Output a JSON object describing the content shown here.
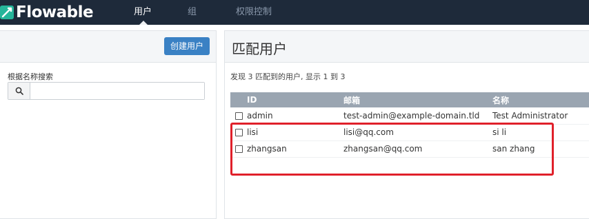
{
  "brand": {
    "name": "Flowable",
    "color": "#26b59a"
  },
  "nav": {
    "tabs": [
      {
        "label": "用户",
        "active": true
      },
      {
        "label": "组",
        "active": false
      },
      {
        "label": "权限控制",
        "active": false
      }
    ]
  },
  "left": {
    "create_button": "创建用户",
    "search_label": "根据名称搜索",
    "search_value": ""
  },
  "right": {
    "title": "匹配用户",
    "summary": "发现 3 匹配到的用户, 显示 1 到 3",
    "columns": [
      "ID",
      "邮箱",
      "名称"
    ],
    "rows": [
      {
        "id": "admin",
        "email": "test-admin@example-domain.tld",
        "name": "Test Administrator"
      },
      {
        "id": "lisi",
        "email": "lisi@qq.com",
        "name": "si li"
      },
      {
        "id": "zhangsan",
        "email": "zhangsan@qq.com",
        "name": "san zhang"
      }
    ]
  },
  "colors": {
    "navbar": "#1e2a3a",
    "primary_button": "#3a81c4",
    "table_header": "#9aa5b1",
    "highlight": "#e0202a"
  }
}
